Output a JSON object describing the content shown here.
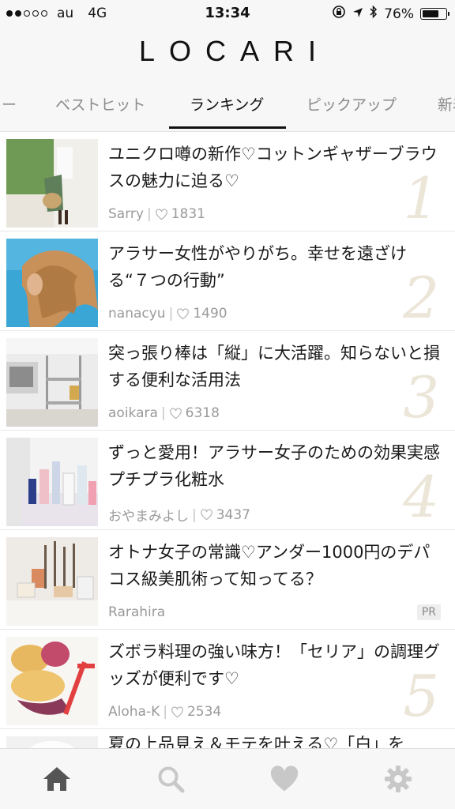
{
  "status_bar": {
    "signal_dots": 5,
    "signal_filled": 2,
    "carrier": "au",
    "network": "4G",
    "time": "13:34",
    "battery_text": "76%",
    "battery_level": 0.76
  },
  "header": {
    "logo": "LOCARI"
  },
  "tabs": [
    {
      "label": "ー"
    },
    {
      "label": "ベストヒット"
    },
    {
      "label": "ランキング",
      "active": true
    },
    {
      "label": "ピックアップ"
    },
    {
      "label": "新着"
    }
  ],
  "articles": [
    {
      "title": "ユニクロ噂の新作♡コットンギャザーブラウスの魅力に迫る♡",
      "author": "Sarry",
      "likes": "1831",
      "rank": "1",
      "thumb": "fashion-street-photo"
    },
    {
      "title": "アラサー女性がやりがち。幸せを遠ざける“７つの行動”",
      "author": "nanacyu",
      "likes": "1490",
      "rank": "2",
      "thumb": "woman-hair-sky-photo"
    },
    {
      "title": "突っ張り棒は「縦」に大活躍。知らないと損する便利な活用法",
      "author": "aoikara",
      "likes": "6318",
      "rank": "3",
      "thumb": "kitchen-rack-photo"
    },
    {
      "title": "ずっと愛用！アラサー女子のための効果実感プチプラ化粧水",
      "author": "おやまみよし",
      "likes": "3437",
      "rank": "4",
      "thumb": "cosmetics-bottles-photo"
    },
    {
      "title": "オトナ女子の常識♡アンダー1000円のデパコス級美肌術って知ってる？",
      "author": "Rarahira",
      "badge": "PR",
      "thumb": "makeup-brushes-photo"
    },
    {
      "title": "ズボラ料理の強い味方！「セリア」の調理グッズが便利です♡",
      "author": "Aloha-K",
      "likes": "2534",
      "rank": "5",
      "thumb": "sweet-potato-slicer-photo"
    },
    {
      "title": "夏の上品見え＆モテを叶える♡「白」を",
      "thumb": "white-fashion-photo"
    }
  ],
  "bottom_nav": [
    {
      "icon": "home-icon",
      "active": true
    },
    {
      "icon": "search-icon"
    },
    {
      "icon": "heart-icon"
    },
    {
      "icon": "gear-icon"
    }
  ],
  "colors": {
    "bar_bg": "#f7f7f7",
    "rank_numeral": "#ece6d9",
    "meta_text": "#9a9a9a",
    "nav_icon": "#c8c8c8",
    "nav_icon_active": "#555555"
  }
}
